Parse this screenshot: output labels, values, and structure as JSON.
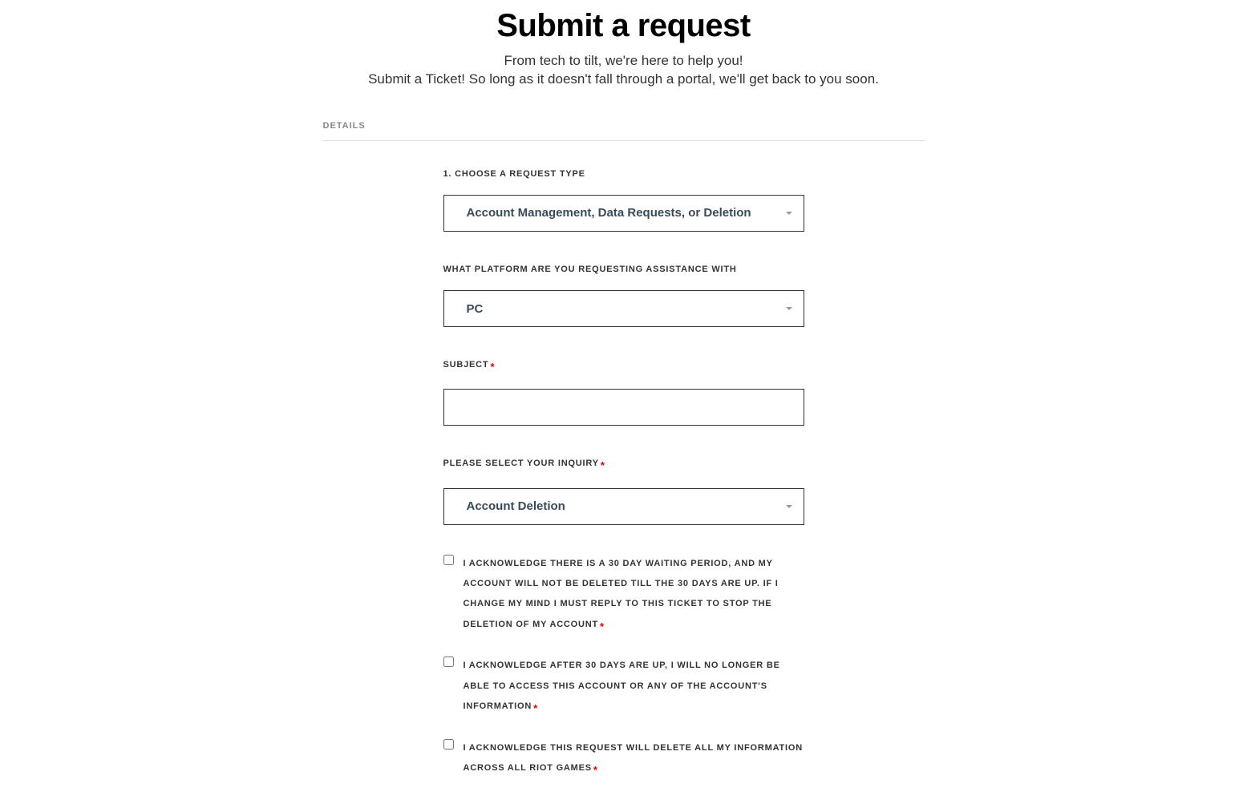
{
  "header": {
    "title": "Submit a request",
    "subtitle_line1": "From tech to tilt, we're here to help you!",
    "subtitle_line2": "Submit a Ticket! So long as it doesn't fall through a portal, we'll get back to you soon."
  },
  "section_label": "DETAILS",
  "fields": {
    "request_type": {
      "label": "1. CHOOSE A REQUEST TYPE",
      "value": "Account Management, Data Requests, or Deletion"
    },
    "platform": {
      "label": "WHAT PLATFORM ARE YOU REQUESTING ASSISTANCE WITH",
      "value": "PC"
    },
    "subject": {
      "label": "SUBJECT",
      "value": ""
    },
    "inquiry": {
      "label": "PLEASE SELECT YOUR INQUIRY",
      "value": "Account Deletion"
    },
    "ack1": {
      "label": "I ACKNOWLEDGE THERE IS A 30 DAY WAITING PERIOD, AND MY ACCOUNT WILL NOT BE DELETED TILL THE 30 DAYS ARE UP. IF I CHANGE MY MIND I MUST REPLY TO THIS TICKET TO STOP THE DELETION OF MY ACCOUNT"
    },
    "ack2": {
      "label": "I ACKNOWLEDGE AFTER 30 DAYS ARE UP, I WILL NO LONGER BE ABLE TO ACCESS THIS ACCOUNT OR ANY OF THE ACCOUNT'S INFORMATION"
    },
    "ack3": {
      "label": "I ACKNOWLEDGE THIS REQUEST WILL DELETE ALL MY INFORMATION ACROSS ALL RIOT GAMES"
    }
  },
  "required_mark": "*"
}
